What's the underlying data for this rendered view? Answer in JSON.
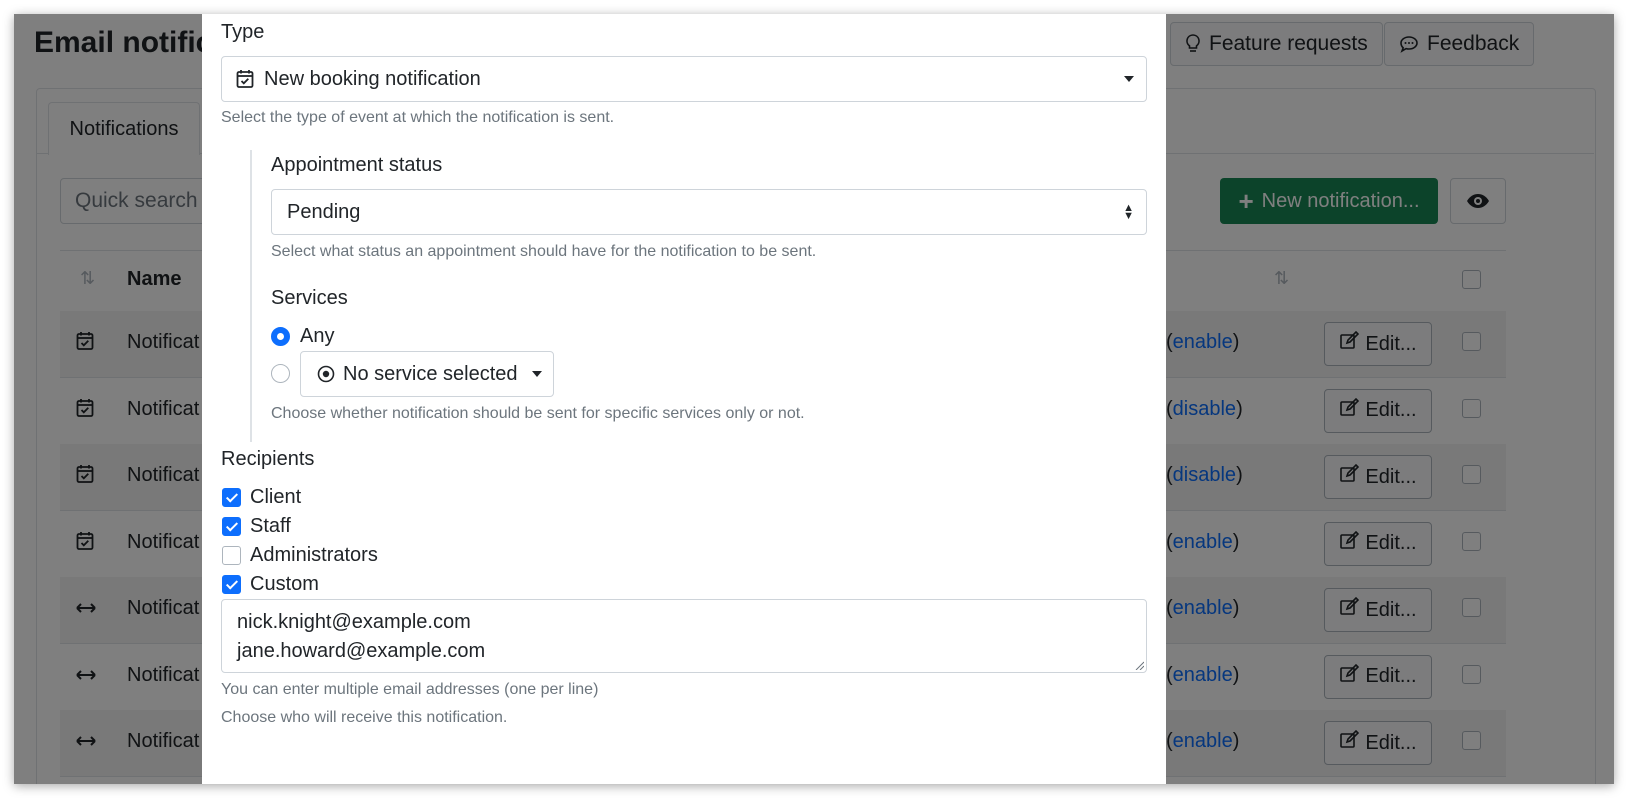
{
  "page": {
    "title": "Email notifica",
    "feature_requests": "Feature requests",
    "feedback": "Feedback",
    "tab_notifications": "Notifications",
    "quick_search": "Quick search n",
    "new_notification": "New notification...",
    "col_name": "Name",
    "edit_label": "Edit...",
    "rows": [
      {
        "icon": "calendar-check-icon",
        "name": "Notificat",
        "toggle": "enable"
      },
      {
        "icon": "calendar-check-icon",
        "name": "Notificat",
        "toggle": "disable"
      },
      {
        "icon": "calendar-check-icon",
        "name": "Notificat",
        "toggle": "disable"
      },
      {
        "icon": "calendar-check-icon",
        "name": "Notificat",
        "toggle": "enable"
      },
      {
        "icon": "arrows-horizontal-icon",
        "name": "Notificat",
        "toggle": "enable"
      },
      {
        "icon": "arrows-horizontal-icon",
        "name": "Notificat",
        "toggle": "enable"
      },
      {
        "icon": "arrows-horizontal-icon",
        "name": "Notificat",
        "toggle": "enable"
      }
    ]
  },
  "modal": {
    "type_label": "Type",
    "type_value": "New booking notification",
    "type_help": "Select the type of event at which the notification is sent.",
    "status_label": "Appointment status",
    "status_value": "Pending",
    "status_help": "Select what status an appointment should have for the notification to be sent.",
    "services_label": "Services",
    "services_any": "Any",
    "services_selected": "No service selected",
    "services_help": "Choose whether notification should be sent for specific services only or not.",
    "recipients_label": "Recipients",
    "recipients": [
      {
        "label": "Client",
        "checked": true
      },
      {
        "label": "Staff",
        "checked": true
      },
      {
        "label": "Administrators",
        "checked": false
      },
      {
        "label": "Custom",
        "checked": true
      }
    ],
    "custom_emails": [
      "nick.knight@example.com",
      "jane.howard@example.com"
    ],
    "custom_help": "You can enter multiple email addresses (one per line)",
    "recipients_help": "Choose who will receive this notification."
  },
  "colors": {
    "primary": "#0d6efd",
    "success": "#198754",
    "link": "#0d6efd"
  }
}
